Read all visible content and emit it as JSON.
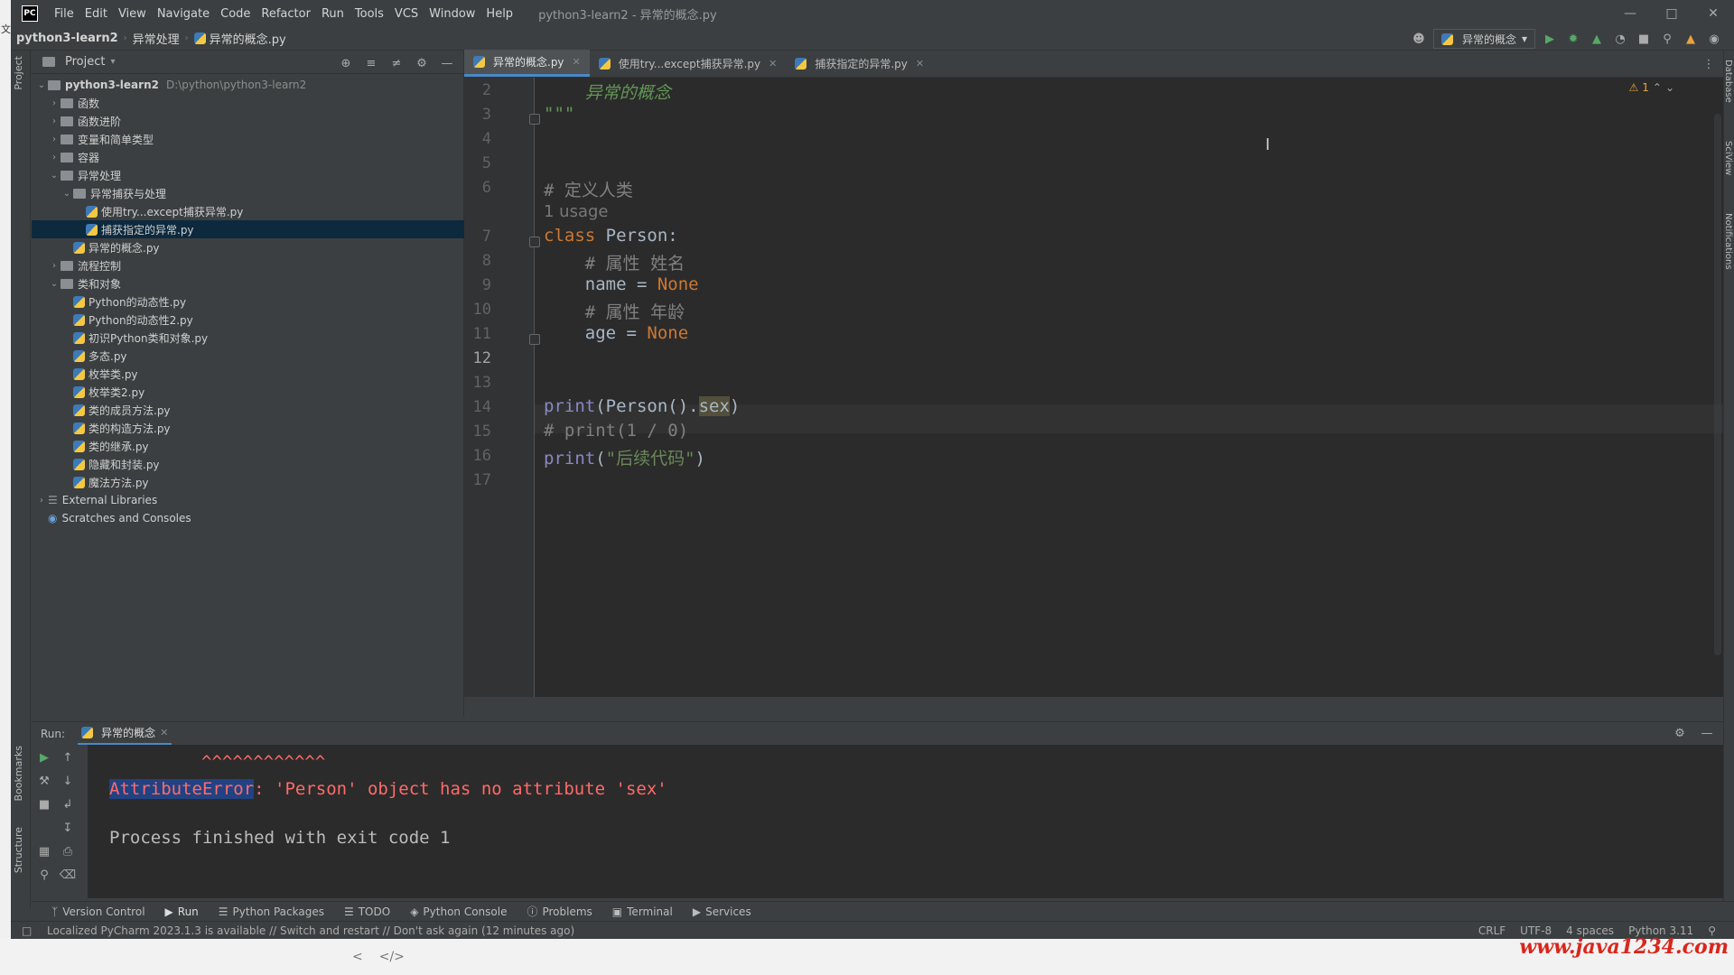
{
  "window": {
    "title": "python3-learn2 - 异常的概念.py",
    "menu": [
      "File",
      "Edit",
      "View",
      "Navigate",
      "Code",
      "Refactor",
      "Run",
      "Tools",
      "VCS",
      "Window",
      "Help"
    ]
  },
  "breadcrumb": [
    "python3-learn2",
    "异常处理",
    "异常的概念.py"
  ],
  "run_config": "异常的概念",
  "project": {
    "header": "Project",
    "root": {
      "name": "python3-learn2",
      "path": "D:\\python\\python3-learn2"
    },
    "items": [
      {
        "name": "函数",
        "type": "folder",
        "depth": 1,
        "expanded": false
      },
      {
        "name": "函数进阶",
        "type": "folder",
        "depth": 1,
        "expanded": false
      },
      {
        "name": "变量和简单类型",
        "type": "folder",
        "depth": 1,
        "expanded": false
      },
      {
        "name": "容器",
        "type": "folder",
        "depth": 1,
        "expanded": false
      },
      {
        "name": "异常处理",
        "type": "folder",
        "depth": 1,
        "expanded": true
      },
      {
        "name": "异常捕获与处理",
        "type": "folder",
        "depth": 2,
        "expanded": true
      },
      {
        "name": "使用try...except捕获异常.py",
        "type": "file",
        "depth": 3
      },
      {
        "name": "捕获指定的异常.py",
        "type": "file",
        "depth": 3,
        "selected": true
      },
      {
        "name": "异常的概念.py",
        "type": "file",
        "depth": 2
      },
      {
        "name": "流程控制",
        "type": "folder",
        "depth": 1,
        "expanded": false
      },
      {
        "name": "类和对象",
        "type": "folder",
        "depth": 1,
        "expanded": true
      },
      {
        "name": "Python的动态性.py",
        "type": "file",
        "depth": 2
      },
      {
        "name": "Python的动态性2.py",
        "type": "file",
        "depth": 2
      },
      {
        "name": "初识Python类和对象.py",
        "type": "file",
        "depth": 2
      },
      {
        "name": "多态.py",
        "type": "file",
        "depth": 2
      },
      {
        "name": "枚举类.py",
        "type": "file",
        "depth": 2
      },
      {
        "name": "枚举类2.py",
        "type": "file",
        "depth": 2
      },
      {
        "name": "类的成员方法.py",
        "type": "file",
        "depth": 2
      },
      {
        "name": "类的构造方法.py",
        "type": "file",
        "depth": 2
      },
      {
        "name": "类的继承.py",
        "type": "file",
        "depth": 2
      },
      {
        "name": "隐藏和封装.py",
        "type": "file",
        "depth": 2
      },
      {
        "name": "魔法方法.py",
        "type": "file",
        "depth": 2
      }
    ],
    "external": "External Libraries",
    "scratches": "Scratches and Consoles"
  },
  "tabs": [
    {
      "label": "异常的概念.py",
      "active": true
    },
    {
      "label": "使用try...except捕获异常.py",
      "active": false
    },
    {
      "label": "捕获指定的异常.py",
      "active": false
    }
  ],
  "editor": {
    "warning_count": "1",
    "line_numbers": [
      "2",
      "3",
      "4",
      "5",
      "6",
      "7",
      "8",
      "9",
      "10",
      "11",
      "12",
      "13",
      "14",
      "15",
      "16",
      "17"
    ],
    "usage_hint": "1 usage",
    "code": {
      "l2": "    异常的概念",
      "l3": "\"\"\"",
      "l6": "# 定义人类",
      "l7_kw": "class",
      "l7_rest": " Person:",
      "l8": "    # 属性 姓名",
      "l9_a": "    name = ",
      "l9_b": "None",
      "l10": "    # 属性 年龄",
      "l11_a": "    age = ",
      "l11_b": "None",
      "l14_fn": "print",
      "l14_a": "(Person().",
      "l14_hl": "sex",
      "l14_b": ")",
      "l15": "# print(1 / 0)",
      "l16_fn": "print",
      "l16_a": "(",
      "l16_str": "\"后续代码\"",
      "l16_b": ")"
    }
  },
  "run": {
    "label": "Run:",
    "tab": "异常的概念",
    "carets": "^^^^^^^^^^^^",
    "error_type": "AttributeError",
    "error_msg": ": 'Person' object has no attribute 'sex'",
    "exit": "Process finished with exit code 1"
  },
  "tool_tabs": [
    "Version Control",
    "Run",
    "Python Packages",
    "TODO",
    "Python Console",
    "Problems",
    "Terminal",
    "Services"
  ],
  "status": {
    "message": "Localized PyCharm 2023.1.3 is available // Switch and restart // Don't ask again (12 minutes ago)",
    "line_sep": "CRLF",
    "encoding": "UTF-8",
    "indent": "4 spaces",
    "interpreter": "Python 3.11"
  },
  "side_tabs": {
    "project": "Project",
    "bookmarks": "Bookmarks",
    "structure": "Structure",
    "database": "Database",
    "sciview": "SciView",
    "notifications": "Notifications"
  },
  "watermark": "www.java1234.com",
  "left_char": "文"
}
